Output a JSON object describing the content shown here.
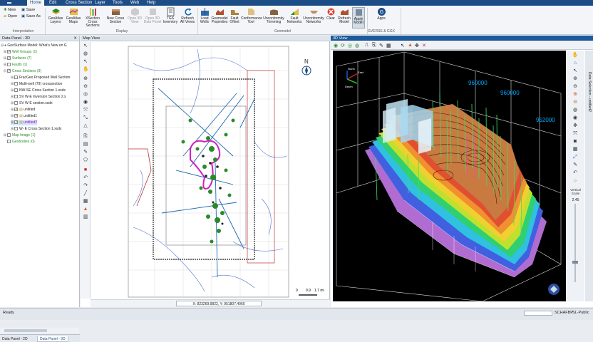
{
  "menu": {
    "items": [
      "Home",
      "Edit",
      "Cross Section",
      "Layer",
      "Tools",
      "Web",
      "Help"
    ],
    "active": "Home"
  },
  "ribbon": {
    "interpretation": {
      "new": "New",
      "open": "Open",
      "save": "Save",
      "save_as": "Save As",
      "label": "Interpretation"
    },
    "display": {
      "buttons": [
        "GeoAtlas Layers",
        "GeoAtlas Maps",
        "XSection Cross Sections",
        "New Cross Section",
        "Open 3D View",
        "Open 3D Data Panel",
        "TGS Inventory",
        "Refresh All Views"
      ],
      "label": "Display"
    },
    "geomodel": {
      "buttons": [
        "Load Wells",
        "Geomodel Properties",
        "Fault Offset",
        "Conformance Tool",
        "Unconformity Trimming",
        "Fault Networks",
        "Unconformity Networks",
        "Clear",
        "Refresh Model",
        "Apply Model"
      ],
      "label": "Geomodel"
    },
    "apps": {
      "button": "Apps",
      "label": "GVERSE & GGX"
    }
  },
  "left_panel": {
    "title": "Data Panel - 3D",
    "root": "GeoSurface Model: What's New on G",
    "items": [
      {
        "label": "Well Groups (1)",
        "color": "green",
        "checked": true
      },
      {
        "label": "Surfaces (7)",
        "color": "green",
        "checked": true
      },
      {
        "label": "Faults (1)",
        "color": "green",
        "checked": false
      },
      {
        "label": "Cross Sections (9)",
        "color": "green",
        "checked": true
      },
      {
        "label": "FracGeo Proposed Well Section",
        "color": "normal",
        "checked": false
      },
      {
        "label": "Multi-well (79) crosssection",
        "color": "normal",
        "checked": false
      },
      {
        "label": "NW-SE Cross Section 1.xsdx",
        "color": "normal",
        "checked": false
      },
      {
        "label": "SV W-E Inversion Section 2.x",
        "color": "normal",
        "checked": false
      },
      {
        "label": "SV W-E section.xsdx",
        "color": "normal",
        "checked": false
      },
      {
        "label": "untitled",
        "color": "normal",
        "checked": true
      },
      {
        "label": "untitled1",
        "color": "normal",
        "checked": true
      },
      {
        "label": "untitled2",
        "color": "magenta",
        "checked": true
      },
      {
        "label": "W- E Cross Section 1.xsdx",
        "color": "normal",
        "checked": false
      },
      {
        "label": "Map Image (1)",
        "color": "green",
        "checked": false
      },
      {
        "label": "Geobodies (0)",
        "color": "green",
        "checked": false
      }
    ],
    "tabs": [
      "Data Panel - 2D",
      "Data Panel - 3D"
    ],
    "active_tab": "Data Panel - 3D"
  },
  "map_view": {
    "title": "Map View",
    "coords": "X: 823269.9822, Y: 951807.4060",
    "north": "N",
    "scale_labels": [
      "0",
      "0.9",
      "1.7 mi"
    ]
  },
  "view_3d": {
    "title": "3D View",
    "axis_labels": [
      "960000",
      "960000",
      "952000"
    ],
    "vertical_scale_label": "Vertical Scale",
    "vertical_scale_value": "2.45",
    "side_tab": "Data Selection - untitled2",
    "compass": [
      "East",
      "North",
      "Depth"
    ]
  },
  "status": {
    "left": "Ready",
    "user": "SCHAFBP",
    "license": "SL-Public"
  },
  "colors": {
    "ribbon_blue": "#1c4d86",
    "magenta": "#d020c0",
    "cyan": "#00aaff"
  }
}
